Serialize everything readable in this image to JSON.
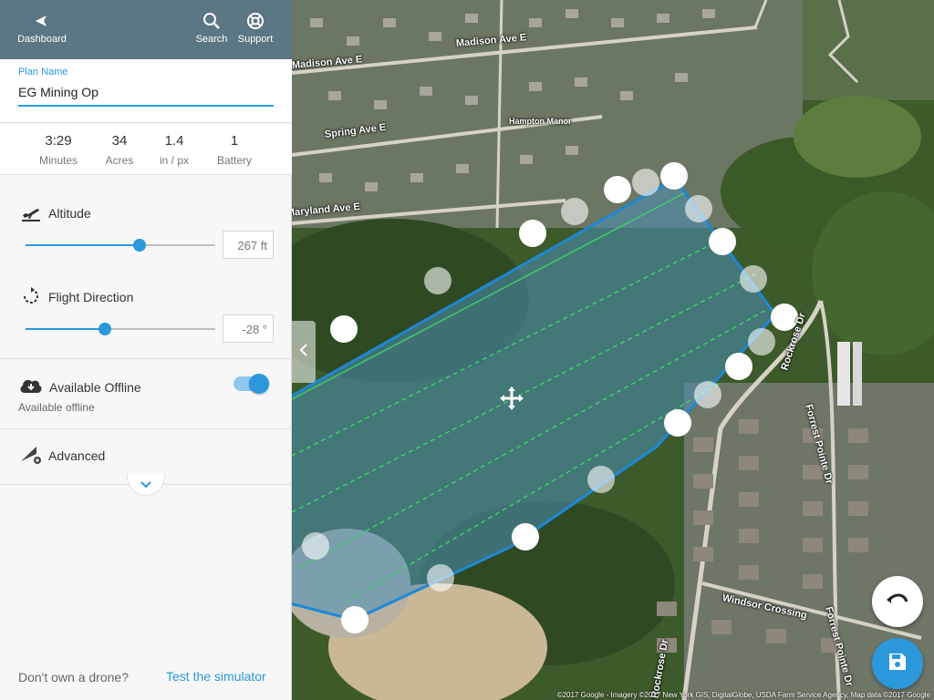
{
  "topbar": {
    "dashboard_label": "Dashboard",
    "search_label": "Search",
    "support_label": "Support"
  },
  "plan": {
    "name_label": "Plan Name",
    "name_value": "EG Mining Op"
  },
  "stats": [
    {
      "value": "3:29",
      "unit": "Minutes"
    },
    {
      "value": "34",
      "unit": "Acres"
    },
    {
      "value": "1.4",
      "unit": "in / px"
    },
    {
      "value": "1",
      "unit": "Battery"
    }
  ],
  "altitude": {
    "label": "Altitude",
    "value": "267 ft",
    "level": 0.6
  },
  "flight_direction": {
    "label": "Flight Direction",
    "value": "-28 °",
    "level": 0.42
  },
  "offline": {
    "label": "Available Offline",
    "sublabel": "Available offline",
    "enabled": true
  },
  "advanced": {
    "label": "Advanced"
  },
  "footer": {
    "question": "Don't own a drone?",
    "link": "Test the simulator"
  },
  "map": {
    "streets": [
      "Madison Ave E",
      "Madison Ave E",
      "Spring Ave E",
      "Maryland Ave E",
      "Hampton Manor",
      "Rockrose Dr",
      "Forrest Pointe Dr",
      "Windsor Crossing",
      "Rockrose Dr",
      "Forrest Pointe Dr"
    ],
    "copyright": "©2017 Google - Imagery ©2017 New York GIS, DigitalGlobe, USDA Farm Service Agency, Map data ©2017 Google",
    "colors": {
      "accent": "#2a98db",
      "topbar": "#5b7685",
      "flight_line": "#3ecf6a",
      "area_fill": "#4a8fb8"
    }
  },
  "icons": {
    "back": "arrow-back-icon",
    "search": "search-icon",
    "support": "lifebuoy-icon",
    "altitude": "airplane-takeoff-icon",
    "direction": "rotate-icon",
    "offline": "cloud-download-icon",
    "advanced": "advanced-settings-icon",
    "expand": "chevron-down-icon",
    "collapse": "chevron-left-icon",
    "move": "move-icon",
    "undo": "undo-icon",
    "save": "save-icon"
  }
}
